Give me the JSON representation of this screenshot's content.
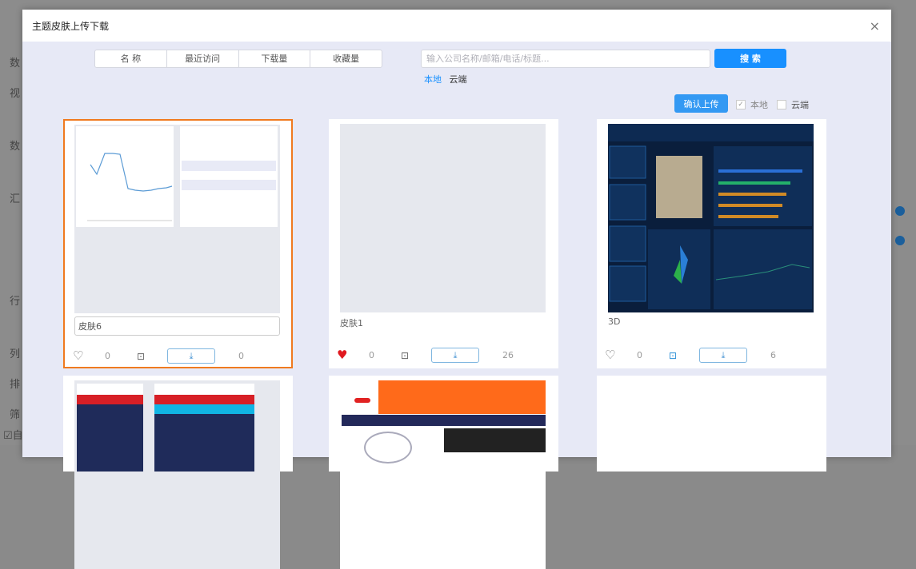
{
  "background": {
    "labels": [
      "数",
      "视",
      "数",
      "汇",
      "行",
      "列",
      "排",
      "筛"
    ],
    "checkbox_label": "自"
  },
  "modal": {
    "title": "主题皮肤上传下载",
    "close": "×"
  },
  "sort_tabs": [
    "名 称",
    "最近访问",
    "下载量",
    "收藏量"
  ],
  "search": {
    "placeholder": "输入公司名称/邮箱/电话/标题...",
    "value": "",
    "button": "搜 索"
  },
  "sources": {
    "local": "本地",
    "cloud": "云端",
    "active_color": "#1890ff"
  },
  "upload": {
    "button": "确认上传",
    "local_label": "本地",
    "local_checked": true,
    "cloud_label": "云端",
    "cloud_checked": false
  },
  "cards": [
    {
      "name": "皮肤6",
      "likes": "0",
      "downloads": "0",
      "liked": false,
      "locked": true,
      "selected": true
    },
    {
      "name": "皮肤1",
      "likes": "0",
      "downloads": "26",
      "liked": true,
      "locked": true
    },
    {
      "name": "3D",
      "likes": "0",
      "downloads": "6",
      "liked": false,
      "locked": false
    }
  ],
  "icons": {
    "heart": "♡",
    "heart_filled": "♥",
    "lock": "🔒",
    "download": "⤓"
  }
}
